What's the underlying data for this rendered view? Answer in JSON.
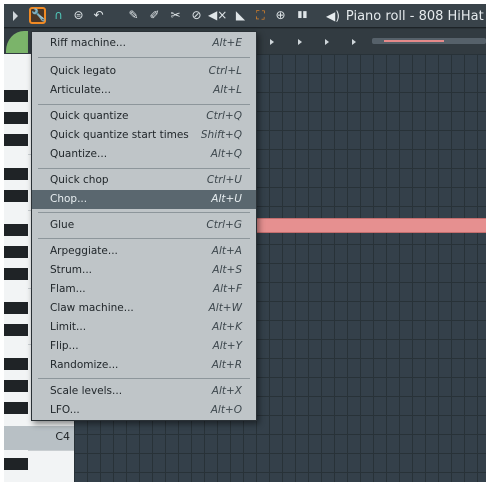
{
  "toolbar": {
    "title": "Piano roll - 808 HiHat",
    "tools": [
      {
        "name": "wrench-icon",
        "glyph": "🔧",
        "active": true
      },
      {
        "name": "magnet-icon",
        "glyph": "∩",
        "active": false
      },
      {
        "name": "playback-icon",
        "glyph": "⊜",
        "active": false
      },
      {
        "name": "undo-icon",
        "glyph": "↶",
        "active": false
      },
      {
        "name": "pencil-icon",
        "glyph": "✎",
        "active": false
      },
      {
        "name": "paint-brush-icon",
        "glyph": "✐",
        "active": false
      },
      {
        "name": "erase-icon",
        "glyph": "✂",
        "active": false
      },
      {
        "name": "delete-icon",
        "glyph": "⊘",
        "active": false
      },
      {
        "name": "mute-icon",
        "glyph": "◀×",
        "active": false
      },
      {
        "name": "slip-icon",
        "glyph": "◣",
        "active": false
      },
      {
        "name": "select-icon",
        "glyph": "⛶",
        "active": false
      },
      {
        "name": "zoom-icon",
        "glyph": "⊕",
        "active": false
      },
      {
        "name": "playback-bars-icon",
        "glyph": "▮▮",
        "active": false
      }
    ]
  },
  "key_label": "C4",
  "menu": {
    "items": [
      {
        "label": "Riff machine...",
        "shortcut": "Alt+E"
      },
      {
        "label": "Quick legato",
        "shortcut": "Ctrl+L"
      },
      {
        "label": "Articulate...",
        "shortcut": "Alt+L"
      },
      {
        "label": "Quick quantize",
        "shortcut": "Ctrl+Q"
      },
      {
        "label": "Quick quantize start times",
        "shortcut": "Shift+Q"
      },
      {
        "label": "Quantize...",
        "shortcut": "Alt+Q"
      },
      {
        "label": "Quick chop",
        "shortcut": "Ctrl+U"
      },
      {
        "label": "Chop...",
        "shortcut": "Alt+U"
      },
      {
        "label": "Glue",
        "shortcut": "Ctrl+G"
      },
      {
        "label": "Arpeggiate...",
        "shortcut": "Alt+A"
      },
      {
        "label": "Strum...",
        "shortcut": "Alt+S"
      },
      {
        "label": "Flam...",
        "shortcut": "Alt+F"
      },
      {
        "label": "Claw machine...",
        "shortcut": "Alt+W"
      },
      {
        "label": "Limit...",
        "shortcut": "Alt+K"
      },
      {
        "label": "Flip...",
        "shortcut": "Alt+Y"
      },
      {
        "label": "Randomize...",
        "shortcut": "Alt+R"
      },
      {
        "label": "Scale levels...",
        "shortcut": "Alt+X"
      },
      {
        "label": "LFO...",
        "shortcut": "Alt+O"
      }
    ],
    "highlighted": "Chop..."
  },
  "colors": {
    "accent": "#f08a24",
    "note": "#e69090",
    "menu_bg": "#bfc5c8",
    "menu_highlight": "#5a676f"
  }
}
